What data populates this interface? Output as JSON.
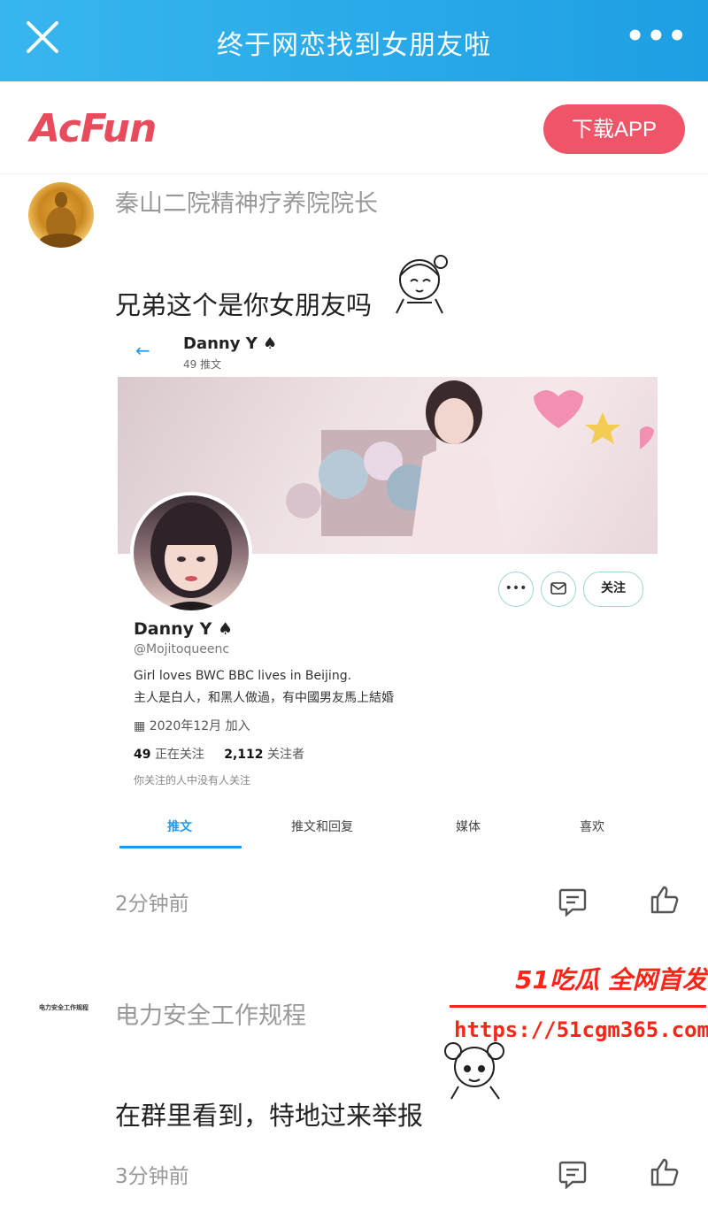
{
  "header": {
    "title": "终于网恋找到女朋友啦",
    "more_label": "•••"
  },
  "brand": {
    "logo_text": "AcFun",
    "download_label": "下载APP"
  },
  "comments": [
    {
      "username": "秦山二院精神疗养院院长",
      "text": "兄弟这个是你女朋友吗",
      "time": "2分钟前",
      "screenshot": {
        "header_name": "Danny Y ♠",
        "header_count": "49 推文",
        "name": "Danny Y ♠",
        "handle": "@Mojitoqueenc",
        "bio_line1": "Girl loves BWC BBC lives in Beijing.",
        "bio_line2": "主人是白人，和黑人做過，有中國男友馬上結婚",
        "joined": "2020年12月 加入",
        "following_count": "49",
        "following_label": "正在关注",
        "followers_count": "2,112",
        "followers_label": "关注者",
        "no_follow_text": "你关注的人中没有人关注",
        "follow_label": "关注",
        "tabs": [
          "推文",
          "推文和回复",
          "媒体",
          "喜欢"
        ]
      }
    },
    {
      "username": "电力安全工作规程",
      "avatar_text": "电力安全工作规程",
      "text": "在群里看到，特地过来举报",
      "time": "3分钟前"
    }
  ],
  "watermark": {
    "line1": "51吃瓜 全网首发",
    "line2": "https://51cgm365.com"
  },
  "colors": {
    "topbar": "#1e9fe3",
    "accent": "#f05469",
    "twitter_blue": "#1d9bf0",
    "watermark": "#ff2418"
  }
}
